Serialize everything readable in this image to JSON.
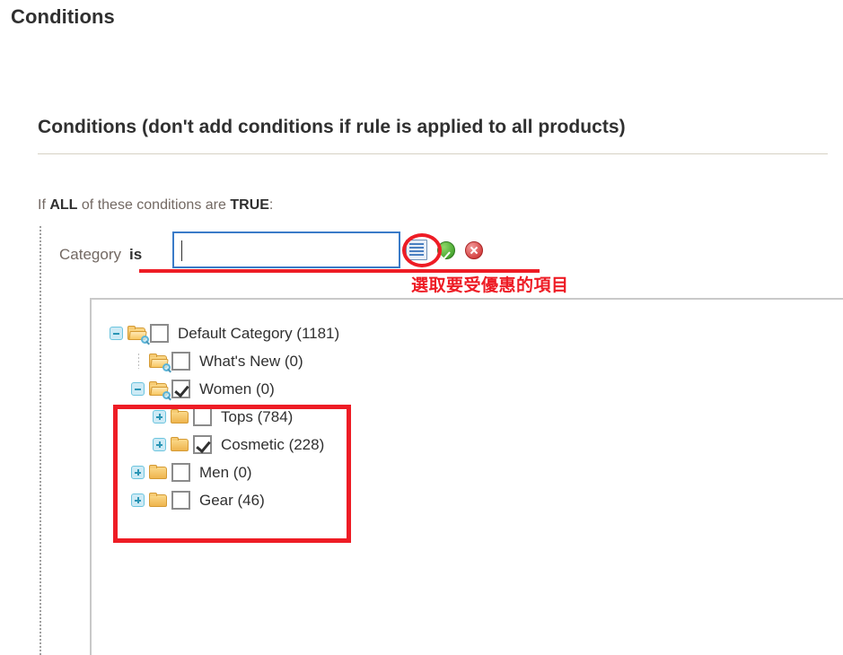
{
  "page": {
    "title": "Conditions"
  },
  "section": {
    "title": "Conditions (don't add conditions if rule is applied to all products)"
  },
  "conditions": {
    "intro": {
      "prefix": "If",
      "aggregator": "ALL",
      "middle": "of these conditions are",
      "value": "TRUE",
      "suffix": ":"
    },
    "row": {
      "attribute": "Category",
      "operator": "is",
      "input_value": "",
      "input_placeholder": "",
      "chooser_icon": "chooser-list-icon",
      "apply_icon": "apply-check-icon",
      "remove_icon": "remove-cross-icon"
    }
  },
  "annotations": {
    "note_text": "選取要受優惠的項目",
    "accent_color": "#ee1c25"
  },
  "tree": {
    "items": [
      {
        "label": "Default Category (1181)",
        "level": 0,
        "expander": "minus",
        "folder": "open-folder-search-icon",
        "checked": false
      },
      {
        "label": "What's New (0)",
        "level": 1,
        "expander": "none",
        "folder": "open-folder-search-icon",
        "checked": false
      },
      {
        "label": "Women (0)",
        "level": 1,
        "expander": "minus",
        "folder": "open-folder-search-icon",
        "checked": true
      },
      {
        "label": "Tops (784)",
        "level": 2,
        "expander": "plus",
        "folder": "closed-folder-icon",
        "checked": false
      },
      {
        "label": "Cosmetic (228)",
        "level": 2,
        "expander": "plus",
        "folder": "closed-folder-icon",
        "checked": true
      },
      {
        "label": "Men (0)",
        "level": 1,
        "expander": "plus",
        "folder": "closed-folder-icon",
        "checked": false
      },
      {
        "label": "Gear (46)",
        "level": 1,
        "expander": "plus",
        "folder": "closed-folder-icon",
        "checked": false
      }
    ]
  }
}
